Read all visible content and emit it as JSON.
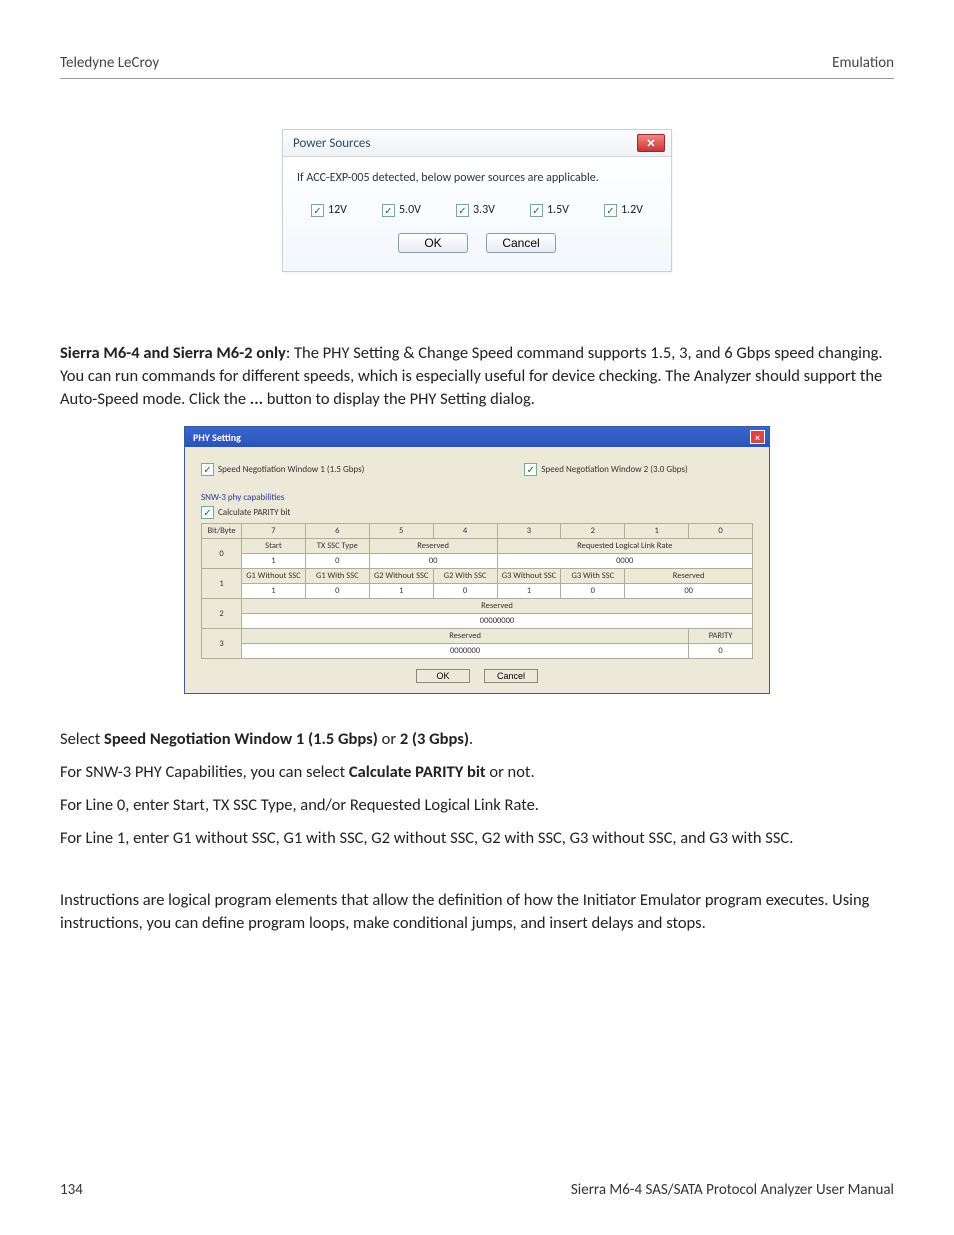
{
  "header": {
    "left": "Teledyne LeCroy",
    "right": "Emulation"
  },
  "power_dialog": {
    "title": "Power Sources",
    "message": "If ACC-EXP-005 detected, below power sources are applicable.",
    "voltages": [
      "12V",
      "5.0V",
      "3.3V",
      "1.5V",
      "1.2V"
    ],
    "ok": "OK",
    "cancel": "Cancel"
  },
  "para1_bold": "Sierra M6-4 and Sierra M6-2 only",
  "para1_rest": ": The PHY Setting & Change Speed command supports 1.5, 3, and 6 Gbps speed changing. You can run commands for different speeds, which is especially useful for device checking. The Analyzer should support the Auto-Speed mode. Click the ",
  "para1_dots": "...",
  "para1_tail": " button to display the PHY Setting dialog.",
  "phy": {
    "title": "PHY Setting",
    "sn1": "Speed Negotiation Window 1 (1.5 Gbps)",
    "sn2": "Speed Negotiation Window 2 (3.0 Gbps)",
    "caps_label": "SNW-3 phy capabilities",
    "parity_label": "Calculate PARITY bit",
    "col_header_first": "Bit/Byte",
    "col_bits": [
      "7",
      "6",
      "5",
      "4",
      "3",
      "2",
      "1",
      "0"
    ],
    "rows": [
      "0",
      "1",
      "2",
      "3"
    ],
    "r0_labels": {
      "start": "Start",
      "tx": "TX SSC Type",
      "reserved": "Reserved",
      "rllr": "Requested Logical Link Rate"
    },
    "r0_vals": {
      "start": "1",
      "tx": "0",
      "reserved": "00",
      "rllr": "0000"
    },
    "r1_labels": {
      "g1w": "G1 Without SSC",
      "g1": "G1 With SSC",
      "g2w": "G2 Without SSC",
      "g2": "G2 With SSC",
      "g3w": "G3 Without SSC",
      "g3": "G3 With SSC",
      "reserved": "Reserved"
    },
    "r1_vals": {
      "g1w": "1",
      "g1": "0",
      "g2w": "1",
      "g2": "0",
      "g3w": "1",
      "g3": "0",
      "reserved": "00"
    },
    "r2_labels": {
      "reserved": "Reserved"
    },
    "r2_vals": {
      "reserved": "00000000"
    },
    "r3_labels": {
      "reserved": "Reserved",
      "parity": "PARITY"
    },
    "r3_vals": {
      "reserved": "0000000",
      "parity": "0"
    },
    "ok": "OK",
    "cancel": "Cancel"
  },
  "p2_pre": "Select ",
  "p2_b1": "Speed Negotiation Window 1 (1.5 Gbps)",
  "p2_mid": " or ",
  "p2_b2": "2 (3 Gbps)",
  "p2_post": ".",
  "p3_pre": "For SNW-3 PHY Capabilities, you can select ",
  "p3_b": "Calculate PARITY bit",
  "p3_post": " or not.",
  "p4": "For Line 0, enter Start, TX SSC Type, and/or Requested Logical Link Rate.",
  "p5": "For Line 1, enter G1 without SSC, G1 with SSC, G2 without SSC, G2 with SSC, G3 without SSC, and G3 with SSC.",
  "p6": "Instructions are logical program elements that allow the definition of how the Initiator Emulator program executes. Using instructions, you can define program loops, make conditional jumps, and insert delays and stops.",
  "footer": {
    "page": "134",
    "title": "Sierra M6-4 SAS/SATA Protocol Analyzer User Manual"
  }
}
